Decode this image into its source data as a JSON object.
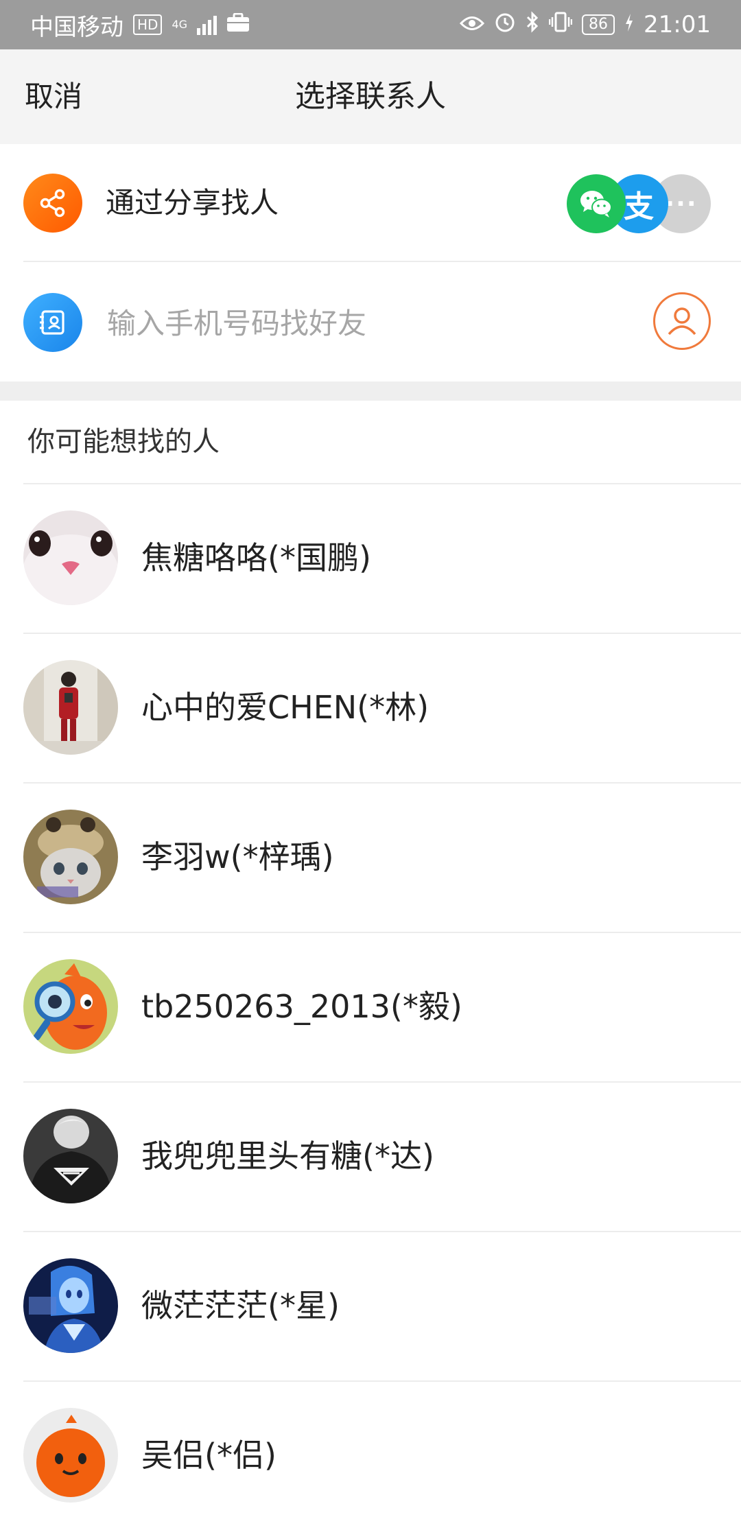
{
  "status_bar": {
    "carrier": "中国移动",
    "hd_badge": "HD",
    "network": "4G",
    "battery": "86",
    "time": "21:01",
    "icons": [
      "briefcase-icon",
      "eye-icon",
      "alarm-icon",
      "bluetooth-icon",
      "vibrate-icon",
      "charging-icon"
    ]
  },
  "nav": {
    "cancel_label": "取消",
    "title": "选择联系人"
  },
  "share_row": {
    "label": "通过分享找人",
    "icon": "share-icon",
    "channels": [
      {
        "name": "wechat",
        "glyph": "",
        "color": "#1fc25c"
      },
      {
        "name": "alipay",
        "glyph": "支",
        "color": "#1d9ded"
      },
      {
        "name": "more",
        "glyph": "···",
        "color": "#d2d2d2"
      }
    ]
  },
  "phone_row": {
    "placeholder": "输入手机号码找好友",
    "value": "",
    "icon": "id-card-icon",
    "contact_book_icon": "person-icon"
  },
  "section": {
    "title": "你可能想找的人"
  },
  "contacts": [
    {
      "name": "焦糖咯咯(*国鹏)",
      "avatar": "kitten-nose"
    },
    {
      "name": "心中的爱CHEN(*林)",
      "avatar": "person-mirror-selfie"
    },
    {
      "name": "李羽w(*梓瑀)",
      "avatar": "kitten-hat"
    },
    {
      "name": "tb250263_2013(*毅)",
      "avatar": "orange-mascot-magnifier"
    },
    {
      "name": "我兜兜里头有糖(*达)",
      "avatar": "superman-shirt-bw"
    },
    {
      "name": "微茫茫茫(*星)",
      "avatar": "anime-blue-girl"
    },
    {
      "name": "吴侣(*侣)",
      "avatar": "orange-pumpkin"
    }
  ],
  "colors": {
    "accent_orange": "#ff6a00",
    "accent_blue": "#2b9af3",
    "status_bar_bg": "#9c9c9c",
    "nav_bg": "#f4f4f4"
  }
}
